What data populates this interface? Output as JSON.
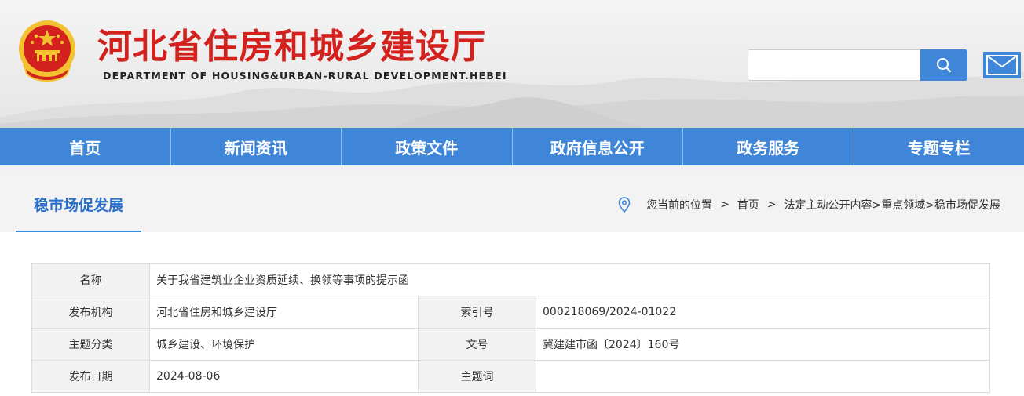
{
  "header": {
    "title": "河北省住房和城乡建设厅",
    "subtitle": "DEPARTMENT OF HOUSING&URBAN-RURAL DEVELOPMENT.HEBEI",
    "emblem_icon": "national-emblem-icon",
    "search": {
      "value": "",
      "placeholder": ""
    },
    "search_icon": "search-icon",
    "mail_icon": "mail-icon"
  },
  "nav": {
    "items": [
      {
        "label": "首页"
      },
      {
        "label": "新闻资讯"
      },
      {
        "label": "政策文件"
      },
      {
        "label": "政府信息公开"
      },
      {
        "label": "政务服务"
      },
      {
        "label": "专题专栏"
      }
    ]
  },
  "column": {
    "title": "稳市场促发展",
    "location_icon": "location-pin-icon",
    "breadcrumb": {
      "prefix": "您当前的位置",
      "home": "首页",
      "path": "法定主动公开内容>重点领域>稳市场促发展"
    }
  },
  "info": {
    "name_label": "名称",
    "name_value": "关于我省建筑业企业资质延续、换领等事项的提示函",
    "publisher_label": "发布机构",
    "publisher_value": "河北省住房和城乡建设厅",
    "index_label": "索引号",
    "index_value": "000218069/2024-01022",
    "category_label": "主题分类",
    "category_value": "城乡建设、环境保护",
    "docno_label": "文号",
    "docno_value": "冀建建市函〔2024〕160号",
    "date_label": "发布日期",
    "date_value": "2024-08-06",
    "keyword_label": "主题词",
    "keyword_value": ""
  },
  "colors": {
    "brand_red": "#d3211e",
    "nav_blue": "#3f86d9",
    "title_blue": "#2a6fc9"
  }
}
